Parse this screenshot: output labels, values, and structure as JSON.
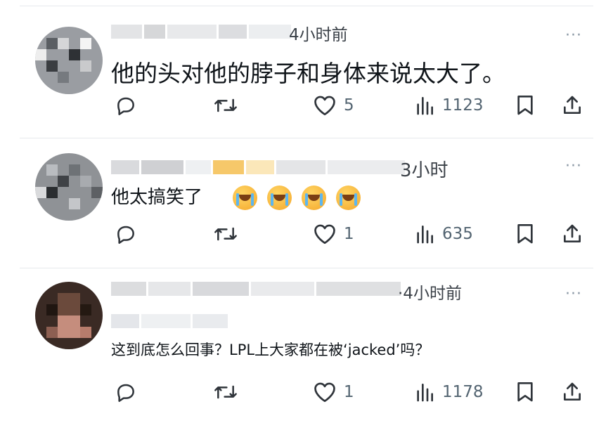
{
  "comments": [
    {
      "time": "4小时前",
      "text": "他的头对他的脖子和身体来说太大了。",
      "likes": "5",
      "views": "1123"
    },
    {
      "time": "3小时",
      "text": "他太搞笑了",
      "emoji": [
        "😭",
        "😭",
        "😭",
        "😭"
      ],
      "likes": "1",
      "views": "635"
    },
    {
      "time": "·4小时前",
      "text": "这到底怎么回事？LPL上大家都在被‘jacked’吗？",
      "likes": "1",
      "views": "1178"
    }
  ],
  "icons": {
    "more": "more-dots-icon",
    "reply": "reply-icon",
    "repost": "repost-icon",
    "like": "heart-icon",
    "views": "views-icon",
    "bookmark": "bookmark-icon",
    "share": "share-icon"
  },
  "more_glyph": "···"
}
